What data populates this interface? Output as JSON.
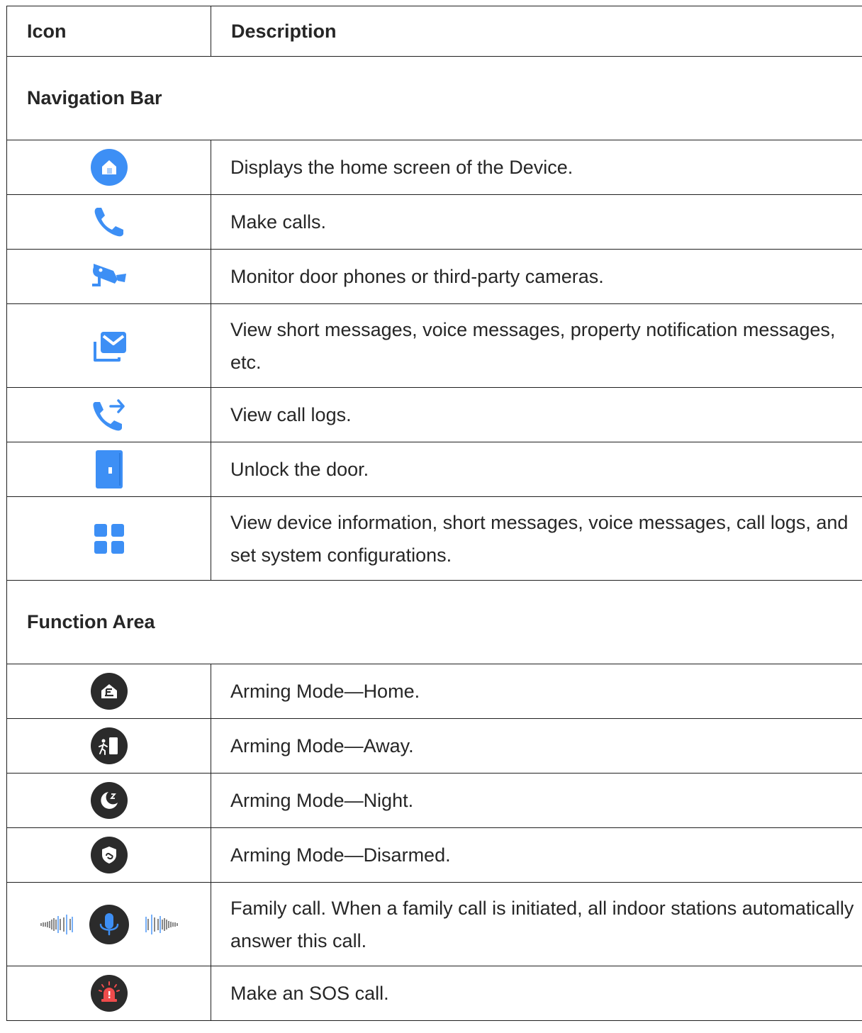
{
  "table": {
    "headers": {
      "icon": "Icon",
      "description": "Description"
    },
    "sections": [
      {
        "title": "Navigation Bar",
        "rows": [
          {
            "icon": "home-icon",
            "description": "Displays the home screen of the Device."
          },
          {
            "icon": "phone-call-icon",
            "description": "Make calls."
          },
          {
            "icon": "surveillance-camera-icon",
            "description": "Monitor door phones or third-party cameras."
          },
          {
            "icon": "message-envelope-icon",
            "description": "View short messages, voice messages, property notification messages, etc."
          },
          {
            "icon": "call-log-icon",
            "description": "View call logs."
          },
          {
            "icon": "door-unlock-icon",
            "description": "Unlock the door."
          },
          {
            "icon": "grid-menu-icon",
            "description": "View device information, short messages, voice messages, call logs, and set system configurations."
          }
        ]
      },
      {
        "title": "Function Area",
        "rows": [
          {
            "icon": "arming-home-icon",
            "description": "Arming Mode—Home."
          },
          {
            "icon": "arming-away-icon",
            "description": "Arming Mode—Away."
          },
          {
            "icon": "arming-night-icon",
            "description": "Arming Mode—Night."
          },
          {
            "icon": "arming-disarmed-icon",
            "description": "Arming Mode—Disarmed."
          },
          {
            "icon": "family-call-microphone-icon",
            "description": "Family call. When a family call is initiated, all indoor stations automatically answer this call."
          },
          {
            "icon": "sos-alarm-icon",
            "description": "Make an SOS call."
          }
        ]
      }
    ]
  },
  "colors": {
    "accent_blue": "#3d8ff5",
    "dark_icon": "#2b2b2b",
    "sos_red": "#ef4b4b",
    "border": "#1f1f1f"
  }
}
